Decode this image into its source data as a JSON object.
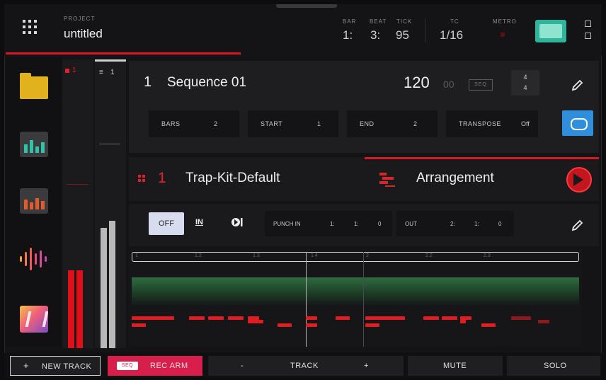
{
  "project": {
    "label": "PROJECT",
    "name": "untitled"
  },
  "transport": {
    "bar_label": "BAR",
    "bar_value": "1:",
    "beat_label": "BEAT",
    "beat_value": "3:",
    "tick_label": "TICK",
    "tick_value": "95",
    "tc_label": "TC",
    "tc_value": "1/16",
    "metro_label": "METRO"
  },
  "meters": [
    {
      "label": "1"
    },
    {
      "label": "1"
    }
  ],
  "sequence": {
    "number": "1",
    "name": "Sequence 01",
    "bpm": "120",
    "bpm_decimal": "00",
    "seq_tag": "SEQ",
    "time_sig_top": "4",
    "time_sig_bottom": "4",
    "bars_label": "BARS",
    "bars_value": "2",
    "start_label": "START",
    "start_value": "1",
    "end_label": "END",
    "end_value": "2",
    "transpose_label": "TRANSPOSE",
    "transpose_value": "Off"
  },
  "track": {
    "number": "1",
    "name": "Trap-Kit-Default"
  },
  "arrangement": {
    "label": "Arrangement"
  },
  "record": {
    "off_label": "OFF",
    "in_label": "IN",
    "punch_in_label": "PUNCH IN",
    "punch_in": [
      "1:",
      "1:",
      "0"
    ],
    "out_label": "OUT",
    "punch_out": [
      "2:",
      "1:",
      "0"
    ]
  },
  "ruler": [
    "1",
    "1.2",
    "1.3",
    "1.4",
    "2",
    "2.2",
    "2.3"
  ],
  "bottom": {
    "new_track": "NEW TRACK",
    "rec_tag": "SEQ",
    "rec_arm": "REC ARM",
    "minus": "-",
    "track": "TRACK",
    "plus": "+",
    "mute": "MUTE",
    "solo": "SOLO"
  },
  "colors": {
    "accent_red": "#d61a22",
    "loop_blue": "#2f8fdc",
    "rec_pink": "#d81f4c",
    "folder_yellow": "#e2b21e",
    "monitor_teal": "#2fb59a"
  }
}
